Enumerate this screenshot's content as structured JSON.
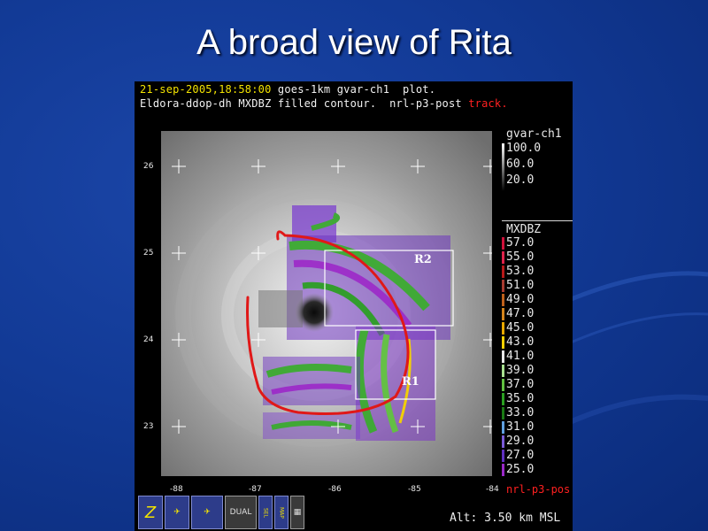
{
  "slide": {
    "title": "A broad view of Rita"
  },
  "plot": {
    "header_line1_date": "21-sep-2005,18:58:00",
    "header_line1_rest": " goes-1km gvar-ch1  plot.",
    "header_line2_main": "Eldora-ddop-dh MXDBZ filled contour.  nrl-p3-post ",
    "header_line2_track": "track.",
    "y_ticks": [
      "26",
      "25",
      "24",
      "23"
    ],
    "x_ticks": [
      "-88",
      "-87",
      "-86",
      "-85",
      "-84"
    ],
    "region_labels": [
      "R2",
      "R1"
    ],
    "altitude": "Alt: 3.50 km MSL",
    "track_label": "nrl-p3-pos"
  },
  "satellite_colorbar": {
    "title": "gvar-ch1",
    "labels": [
      "100.0",
      "60.0",
      "20.0"
    ]
  },
  "radar_colorbar": {
    "title": "MXDBZ",
    "levels": [
      {
        "label": "57.0",
        "color": "#d0103a"
      },
      {
        "label": "55.0",
        "color": "#e0224a"
      },
      {
        "label": "53.0",
        "color": "#b81818"
      },
      {
        "label": "51.0",
        "color": "#a83a30"
      },
      {
        "label": "49.0",
        "color": "#c0601a"
      },
      {
        "label": "47.0",
        "color": "#d4841a"
      },
      {
        "label": "45.0",
        "color": "#e8a800"
      },
      {
        "label": "43.0",
        "color": "#f4d000"
      },
      {
        "label": "41.0",
        "color": "#e8e8e8"
      },
      {
        "label": "39.0",
        "color": "#a8e090"
      },
      {
        "label": "37.0",
        "color": "#60c040"
      },
      {
        "label": "35.0",
        "color": "#2aa020"
      },
      {
        "label": "33.0",
        "color": "#1a7a14"
      },
      {
        "label": "31.0",
        "color": "#60a0e0"
      },
      {
        "label": "29.0",
        "color": "#7a5ad8"
      },
      {
        "label": "27.0",
        "color": "#6030c0"
      },
      {
        "label": "25.0",
        "color": "#9a28c8"
      }
    ]
  },
  "toolbar": {
    "buttons": [
      "Z",
      "DUAL",
      "SEL",
      "MAP"
    ]
  }
}
